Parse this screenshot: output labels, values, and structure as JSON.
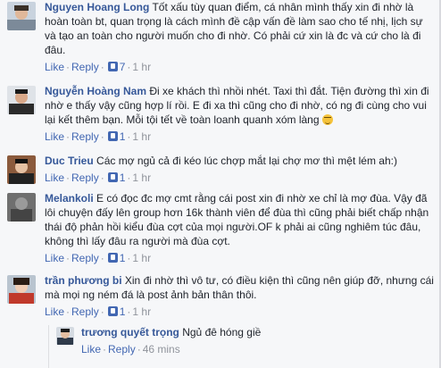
{
  "comments": [
    {
      "author": "Nguyen Hoang Long",
      "text": "Tốt xấu tùy quan điểm, cá nhân mình thấy xin đi nhờ là hoàn toàn bt, quan trọng là cách mình đề cập vấn đề làm sao cho tế nhị, lịch sự và tạo an toàn cho người muốn cho đi nhờ. Có phải cứ xin là đc và cứ cho là đi đâu.",
      "like": "Like",
      "reply": "Reply",
      "likes": "7",
      "time": "1 hr"
    },
    {
      "author": "Nguyễn Hoàng Nam",
      "text": "Đi xe khách thì nhồi nhét. Taxi thì đắt. Tiện đường thì xin đi nhờ e thấy vậy cũng hợp lí rồi. E đi xa thì cũng cho đi nhờ, có ng đi cùng cho vui lại kết thêm bạn. Mỗi tội tết về toàn loanh quanh xóm làng",
      "like": "Like",
      "reply": "Reply",
      "likes": "1",
      "time": "1 hr"
    },
    {
      "author": "Duc Trieu",
      "text": "Các mợ ngủ cả đi kéo lúc chợp mắt lại chợ mơ thì mệt lém ah:)",
      "like": "Like",
      "reply": "Reply",
      "likes": "1",
      "time": "1 hr"
    },
    {
      "author": "Melankoli",
      "text": "E có đọc đc mợ cmt rằng cái post xin đi nhờ xe chỉ là mợ đùa. Vậy đã lôi chuyện đấy lên group hơn 16k thành viên để đùa thì cũng phải biết chấp nhận thái độ phản hồi kiểu đùa cợt của mọi người.OF k phải ai cũng nghiêm túc đâu, không thì lấy đâu ra người mà đùa cợt.",
      "like": "Like",
      "reply": "Reply",
      "likes": "1",
      "time": "1 hr"
    },
    {
      "author": "trần phương bi",
      "text": "Xin đi nhờ thì vô tư, có điều kiện thì cũng nên giúp đỡ, nhưng cái mà mọi ng ném đá là post ảnh bản thân thôi.",
      "like": "Like",
      "reply": "Reply",
      "likes": "1",
      "time": "1 hr"
    }
  ],
  "reply": {
    "author": "trương quyết trọng",
    "text": "Ngủ đê hóng giề",
    "like": "Like",
    "reply": "Reply",
    "time": "46 mins"
  },
  "colors": {
    "name": "#365899",
    "link": "#4267b2",
    "meta": "#90949c",
    "text": "#1d2129",
    "background": "#f6f7f9"
  }
}
